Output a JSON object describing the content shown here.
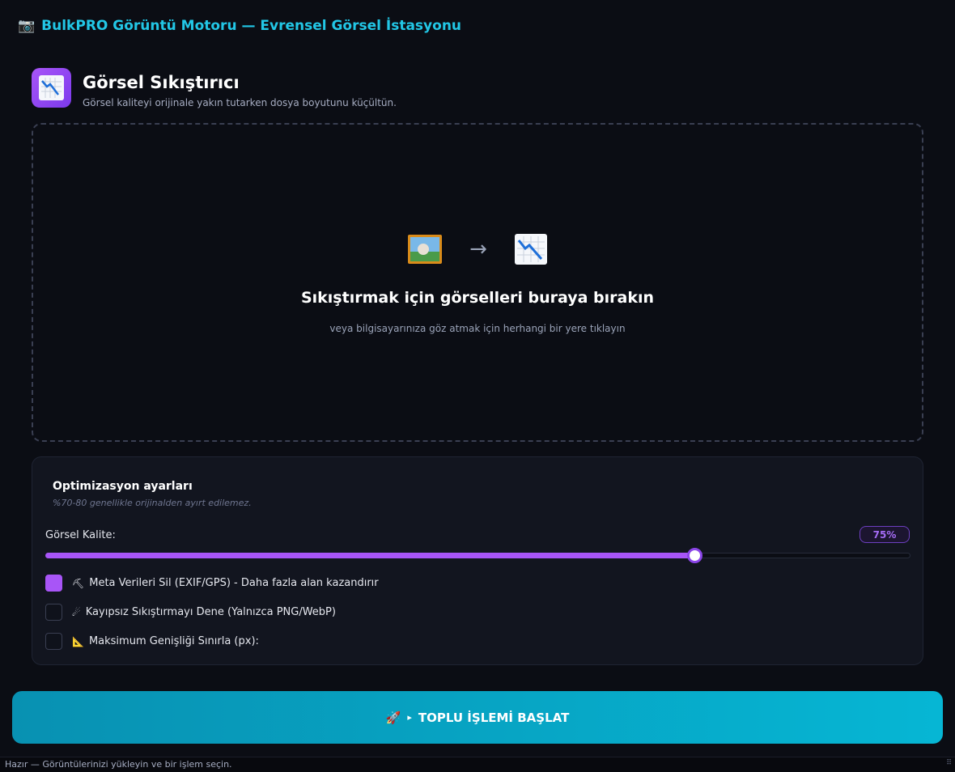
{
  "app": {
    "title": "BulkPRO Görüntü Motoru — Evrensel Görsel İstasyonu",
    "title_icon": "camera-icon"
  },
  "tool": {
    "title": "Görsel Sıkıştırıcı",
    "subtitle": "Görsel kaliteyi orijinale yakın tutarken dosya boyutunu küçültün.",
    "icon": "chart-decreasing-icon"
  },
  "dropzone": {
    "source_icon": "framed-picture-icon",
    "arrow": "→",
    "target_icon": "chart-decreasing-icon",
    "title": "Sıkıştırmak için görselleri buraya bırakın",
    "subtitle": "veya bilgisayarınıza göz atmak için herhangi bir yere tıklayın"
  },
  "settings": {
    "title": "Optimizasyon ayarları",
    "hint": "%70-80 genellikle orijinalden ayırt edilemez.",
    "quality": {
      "label": "Görsel Kalite:",
      "value_text": "75%",
      "value": 75,
      "min": 0,
      "max": 100
    },
    "options": [
      {
        "label": "Meta Verileri Sil (EXIF/GPS) - Daha fazla alan kazandırır",
        "icon": "pick-icon",
        "icon_glyph": "⛏",
        "checked": true
      },
      {
        "label": "Kayıpsız Sıkıştırmayı Dene (Yalnızca PNG/WebP)",
        "icon": "comet-icon",
        "icon_glyph": "☄",
        "checked": false
      },
      {
        "label": "Maksimum Genişliği Sınırla (px):",
        "icon": "triangular-ruler-icon",
        "icon_glyph": "📐",
        "checked": false
      }
    ]
  },
  "start_button": {
    "label": "TOPLU İŞLEMİ BAŞLAT",
    "icon": "rocket-icon",
    "icon_glyph": "🚀",
    "play_glyph": "▸"
  },
  "status": {
    "text": "Hazır — Görüntülerinizi yükleyin ve bir işlem seçin."
  },
  "colors": {
    "accent_purple": "#a855f7",
    "accent_cyan": "#06b6d4",
    "title_cyan": "#22c7e6",
    "background": "#0b0d14"
  }
}
